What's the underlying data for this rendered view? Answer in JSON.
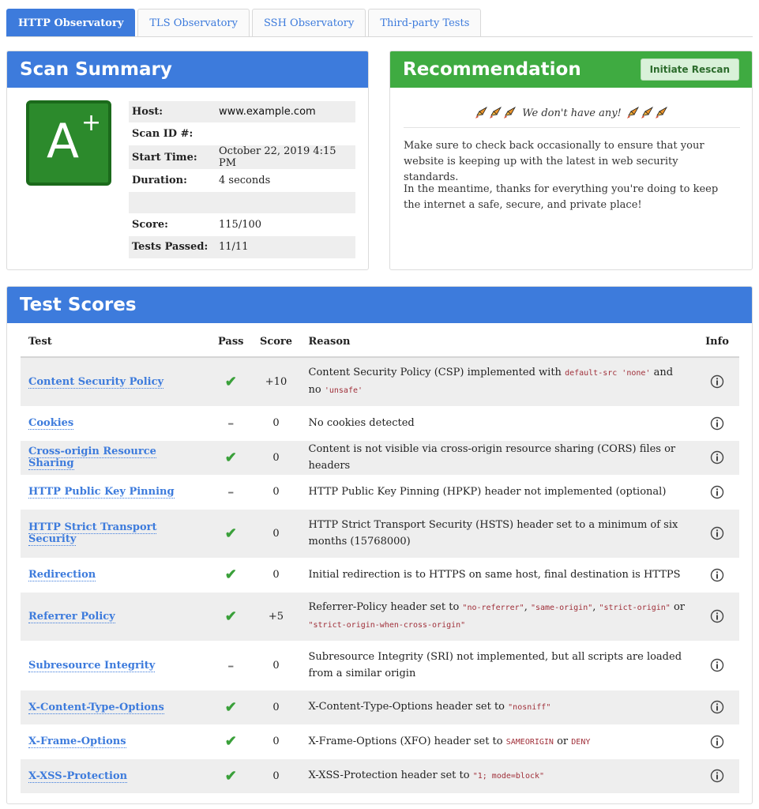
{
  "tabs": [
    {
      "label": "HTTP Observatory",
      "active": true
    },
    {
      "label": "TLS Observatory",
      "active": false
    },
    {
      "label": "SSH Observatory",
      "active": false
    },
    {
      "label": "Third-party Tests",
      "active": false
    }
  ],
  "summary": {
    "title": "Scan Summary",
    "grade": {
      "letter": "A",
      "modifier": "+",
      "color": "#2c8a2c"
    },
    "rows": [
      {
        "key": "Host:",
        "value": "www.example.com"
      },
      {
        "key": "Scan ID #:",
        "value": ""
      },
      {
        "key": "Start Time:",
        "value": "October 22, 2019 4:15 PM"
      },
      {
        "key": "Duration:",
        "value": "4 seconds"
      },
      {
        "key": "",
        "value": ""
      },
      {
        "key": "Score:",
        "value": "115/100"
      },
      {
        "key": "Tests Passed:",
        "value": "11/11"
      }
    ]
  },
  "recommendation": {
    "title": "Recommendation",
    "rescan_label": "Initiate Rescan",
    "headline": "We don't have any!",
    "paragraphs": [
      "Make sure to check back occasionally to ensure that your website is keeping up with the latest in web security standards.",
      "In the meantime, thanks for everything you're doing to keep the internet a safe, secure, and private place!"
    ],
    "icon": "rocket-icon"
  },
  "scores": {
    "title": "Test Scores",
    "columns": {
      "test": "Test",
      "pass": "Pass",
      "score": "Score",
      "reason": "Reason",
      "info": "Info"
    },
    "rows": [
      {
        "test": "Content Security Policy",
        "pass": "check",
        "score": "+10",
        "reason": [
          {
            "t": "Content Security Policy (CSP) implemented with "
          },
          {
            "c": "default-src 'none'"
          },
          {
            "t": " and no "
          },
          {
            "c": "'unsafe'"
          }
        ]
      },
      {
        "test": "Cookies",
        "pass": "dash",
        "score": "0",
        "reason": [
          {
            "t": "No cookies detected"
          }
        ]
      },
      {
        "test": "Cross-origin Resource Sharing",
        "pass": "check",
        "score": "0",
        "reason": [
          {
            "t": "Content is not visible via cross-origin resource sharing (CORS) files or headers"
          }
        ]
      },
      {
        "test": "HTTP Public Key Pinning",
        "pass": "dash",
        "score": "0",
        "reason": [
          {
            "t": "HTTP Public Key Pinning (HPKP) header not implemented (optional)"
          }
        ]
      },
      {
        "test": "HTTP Strict Transport Security",
        "pass": "check",
        "score": "0",
        "reason": [
          {
            "t": "HTTP Strict Transport Security (HSTS) header set to a minimum of six months (15768000)"
          }
        ]
      },
      {
        "test": "Redirection",
        "pass": "check",
        "score": "0",
        "reason": [
          {
            "t": "Initial redirection is to HTTPS on same host, final destination is HTTPS"
          }
        ]
      },
      {
        "test": "Referrer Policy",
        "pass": "check",
        "score": "+5",
        "reason": [
          {
            "t": "Referrer-Policy header set to "
          },
          {
            "c": "\"no-referrer\""
          },
          {
            "t": ", "
          },
          {
            "c": "\"same-origin\""
          },
          {
            "t": ", "
          },
          {
            "c": "\"strict-origin\""
          },
          {
            "t": " or "
          },
          {
            "c": "\"strict-origin-when-cross-origin\""
          }
        ]
      },
      {
        "test": "Subresource Integrity",
        "pass": "dash",
        "score": "0",
        "reason": [
          {
            "t": "Subresource Integrity (SRI) not implemented, but all scripts are loaded from a similar origin"
          }
        ]
      },
      {
        "test": "X-Content-Type-Options",
        "pass": "check",
        "score": "0",
        "reason": [
          {
            "t": "X-Content-Type-Options header set to "
          },
          {
            "c": "\"nosniff\""
          }
        ]
      },
      {
        "test": "X-Frame-Options",
        "pass": "check",
        "score": "0",
        "reason": [
          {
            "t": "X-Frame-Options (XFO) header set to "
          },
          {
            "c": "SAMEORIGIN"
          },
          {
            "t": " or "
          },
          {
            "c": "DENY"
          }
        ]
      },
      {
        "test": "X-XSS-Protection",
        "pass": "check",
        "score": "0",
        "reason": [
          {
            "t": "X-XSS-Protection header set to "
          },
          {
            "c": "\"1; mode=block\""
          }
        ]
      }
    ],
    "info_icon": "info-icon"
  }
}
